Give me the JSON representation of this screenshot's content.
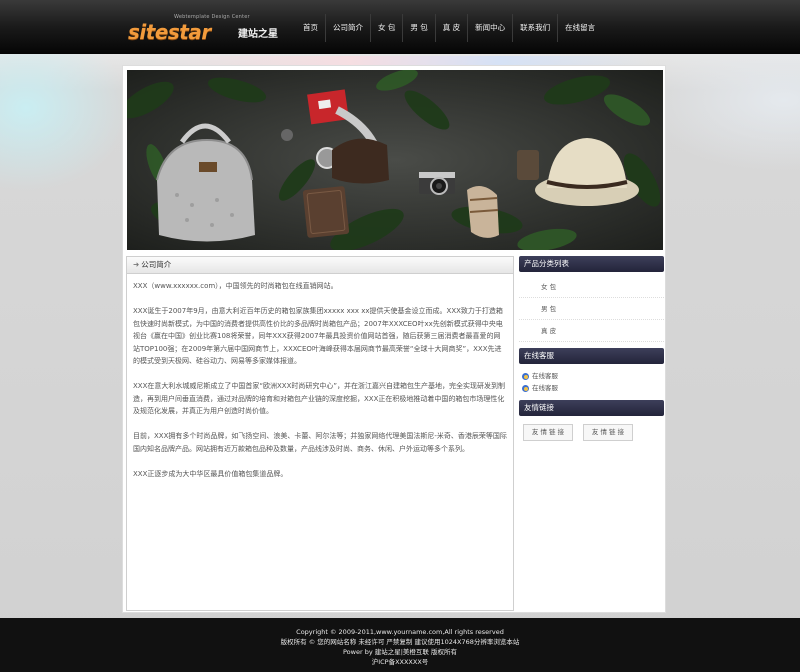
{
  "header": {
    "logo_word": "sitestar",
    "logo_cn": "建站之星",
    "logo_tagline": "Webtemplate Design Center",
    "nav": [
      {
        "label": "首页"
      },
      {
        "label": "公司简介"
      },
      {
        "label": "女 包"
      },
      {
        "label": "男 包"
      },
      {
        "label": "真 皮"
      },
      {
        "label": "新闻中心"
      },
      {
        "label": "联系我们"
      },
      {
        "label": "在线留言"
      }
    ]
  },
  "content": {
    "title": "公司简介",
    "paragraphs": [
      "XXX（www.xxxxxx.com），中国领先的时尚箱包在线直销网站。",
      "XXX诞生于2007年9月，由意大利近百年历史的箱包家族集团xxxxx xxx xx提供天使基金设立而成。XXX致力于打造箱包快速时尚新模式，为中国的消费者提供高性价比的多品牌时尚箱包产品；2007年XXXCEO叶xx先创新模式获得中央电视台《赢在中国》创业比赛108将荣誉，同年XXX获得2007年最具投资价值网站首强，随后获第三届消费者最喜爱的网站TOP100强；在2009年第六届中国网商节上，XXXCEO叶海峰获得本届网商节最高荣誉“全球十大网商奖”，XXX先进的模式受到天极网、硅谷动力、网易等多家媒体报道。",
      "XXX在意大利水城威尼斯成立了中国首家“欧洲XXX时尚研究中心”，并在浙江嘉兴自建箱包生产基地，完全实现研发到制造，再到用户间垂直消费，通过对品牌的培育和对箱包产业链的深度挖掘，XXX正在积极地推动着中国的箱包市场理性化及规范化发展，并真正为用户创造时尚价值。",
      "目前，XXX拥有多个时尚品牌，如飞扬空间、浪美、卡蕾、阿尔法等；并独家网络代理美国法斯尼-米奇、香港辰荣等国际国内知名品牌产品。网站拥有近万款箱包品种及数量，产品线涉及时尚、商务、休闲、户外运动等多个系列。",
      "XXX正逐步成为大中华区最具价值箱包集道品牌。"
    ]
  },
  "sidebar": {
    "categories_title": "产品分类列表",
    "categories": [
      {
        "label": "女 包"
      },
      {
        "label": "男 包"
      },
      {
        "label": "真 皮"
      }
    ],
    "service_title": "在线客服",
    "service": [
      {
        "label": "在线客服"
      },
      {
        "label": "在线客服"
      }
    ],
    "links_title": "友情链接",
    "links": [
      {
        "label": "友 情 链 接"
      },
      {
        "label": "友 情 链 接"
      }
    ]
  },
  "footer": {
    "line1": "Copyright © 2009-2011,www.yourname.com,All rights reserved",
    "line2": "版权所有 © 您的网站名称  未经许可  严禁复制  建议使用1024X768分辨率浏览本站",
    "line3": "Power by 建站之星|美橙互联 版权所有",
    "line4": "沪ICP备XXXXXX号"
  },
  "colors": {
    "header_bg": "#111111",
    "logo_orange": "#f29b3c",
    "side_head_bg": "#2b2c45",
    "footer_bg": "#111111"
  }
}
